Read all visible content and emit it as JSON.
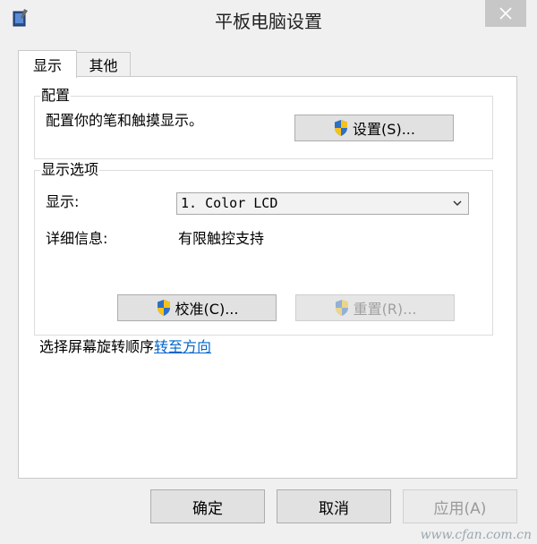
{
  "window": {
    "title": "平板电脑设置",
    "icon": "tablet-pen-icon",
    "close": "close-icon"
  },
  "tabs": [
    {
      "label": "显示",
      "selected": true
    },
    {
      "label": "其他",
      "selected": false
    }
  ],
  "config_group": {
    "legend": "配置",
    "description": "配置你的笔和触摸显示。",
    "setup_button": "设置(S)..."
  },
  "display_group": {
    "legend": "显示选项",
    "display_label": "显示:",
    "display_value": "1. Color LCD",
    "details_label": "详细信息:",
    "details_value": "有限触控支持",
    "calibrate_button": "校准(C)...",
    "reset_button": "重置(R)..."
  },
  "rotation": {
    "text": "选择屏幕旋转顺序",
    "link": "转至方向"
  },
  "footer": {
    "ok": "确定",
    "cancel": "取消",
    "apply": "应用(A)"
  },
  "watermark": "www.cfan.com.cn",
  "colors": {
    "link": "#0066cc",
    "shield_blue": "#2f6fc4",
    "shield_yellow": "#f5c21b"
  }
}
